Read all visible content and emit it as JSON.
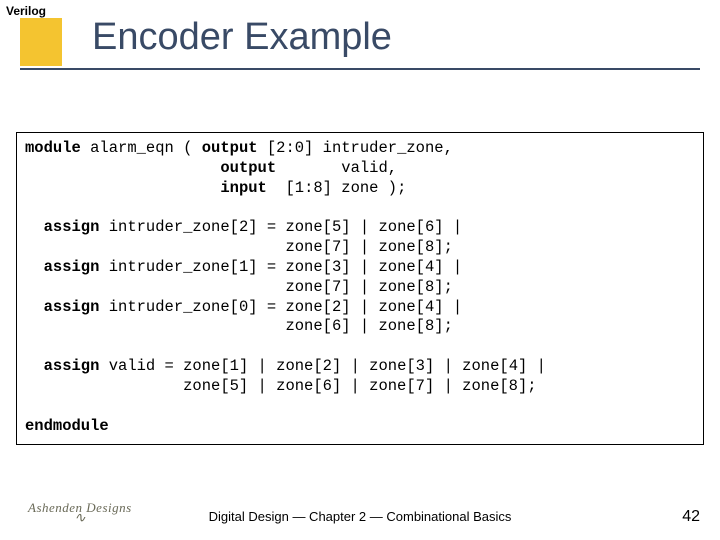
{
  "top_label": "Verilog",
  "title": "Encoder Example",
  "code": {
    "l1a": "module",
    "l1b": " alarm_eqn ( ",
    "l1c": "output",
    "l1d": " [2:0] intruder_zone,",
    "l2a": "                     ",
    "l2b": "output",
    "l2c": "       valid,",
    "l3a": "                     ",
    "l3b": "input",
    "l3c": "  [1:8] zone );",
    "l4a": "  assign",
    "l4b": " intruder_zone[2] = zone[5] | zone[6] |",
    "l5": "                            zone[7] | zone[8];",
    "l6a": "  assign",
    "l6b": " intruder_zone[1] = zone[3] | zone[4] |",
    "l7": "                            zone[7] | zone[8];",
    "l8a": "  assign",
    "l8b": " intruder_zone[0] = zone[2] | zone[4] |",
    "l9": "                            zone[6] | zone[8];",
    "l10a": "  assign",
    "l10b": " valid = zone[1] | zone[2] | zone[3] | zone[4] |",
    "l11": "                 zone[5] | zone[6] | zone[7] | zone[8];",
    "l12": "endmodule"
  },
  "footer": {
    "brand": "Ashenden Designs",
    "wave": "∿",
    "center": "Digital Design — Chapter 2 — Combinational Basics",
    "page": "42"
  }
}
